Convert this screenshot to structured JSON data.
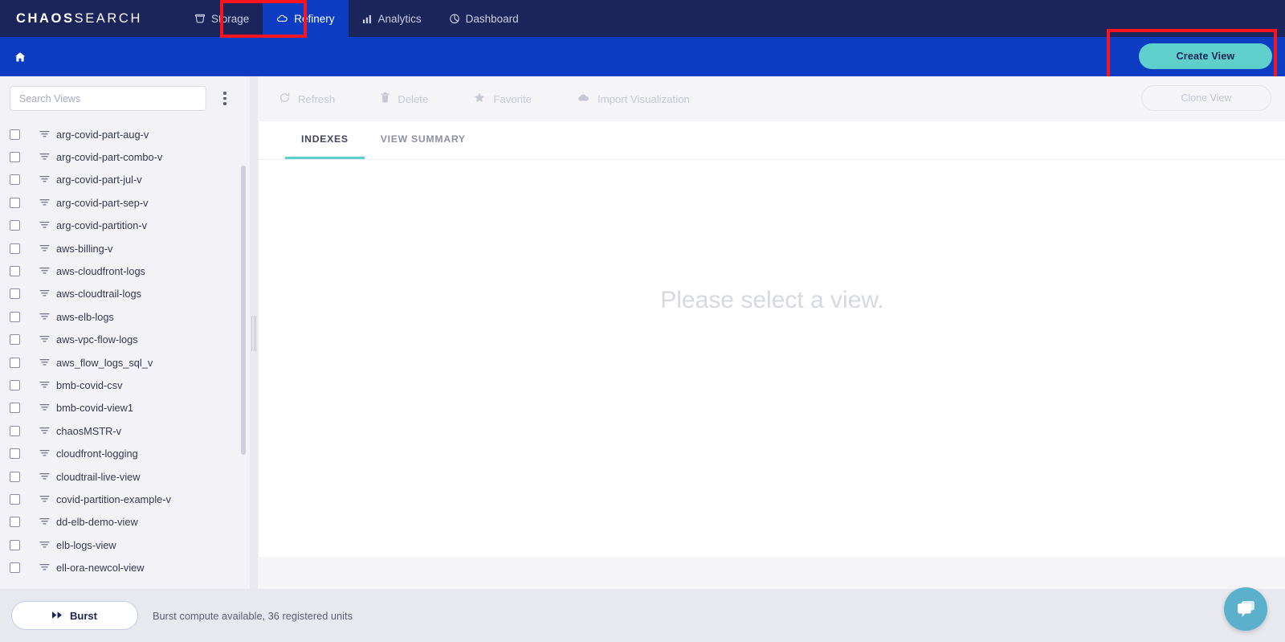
{
  "brand": {
    "bold": "CHAOS",
    "light": "SEARCH"
  },
  "topnav": {
    "items": [
      {
        "label": "Storage",
        "icon": "bucket-icon",
        "active": false
      },
      {
        "label": "Refinery",
        "icon": "cloud-icon",
        "active": true
      },
      {
        "label": "Analytics",
        "icon": "bar-chart-icon",
        "active": false
      },
      {
        "label": "Dashboard",
        "icon": "pie-chart-icon",
        "active": false
      }
    ]
  },
  "subbar": {
    "home_icon": "home-icon",
    "create_view_label": "Create View"
  },
  "sidebar": {
    "search": {
      "placeholder": "Search Views",
      "value": ""
    },
    "menu_icon": "kebab-menu-icon",
    "views": [
      "arg-covid-part-aug-v",
      "arg-covid-part-combo-v",
      "arg-covid-part-jul-v",
      "arg-covid-part-sep-v",
      "arg-covid-partition-v",
      "aws-billing-v",
      "aws-cloudfront-logs",
      "aws-cloudtrail-logs",
      "aws-elb-logs",
      "aws-vpc-flow-logs",
      "aws_flow_logs_sql_v",
      "bmb-covid-csv",
      "bmb-covid-view1",
      "chaosMSTR-v",
      "cloudfront-logging",
      "cloudtrail-live-view",
      "covid-partition-example-v",
      "dd-elb-demo-view",
      "elb-logs-view",
      "ell-ora-newcol-view"
    ]
  },
  "toolbar": {
    "buttons": [
      {
        "label": "Refresh",
        "icon": "refresh-icon"
      },
      {
        "label": "Delete",
        "icon": "trash-icon"
      },
      {
        "label": "Favorite",
        "icon": "star-icon"
      },
      {
        "label": "Import Visualization",
        "icon": "cloud-upload-icon"
      }
    ],
    "clone_label": "Clone View"
  },
  "panel": {
    "tabs": [
      {
        "label": "INDEXES",
        "active": true
      },
      {
        "label": "VIEW SUMMARY",
        "active": false
      }
    ],
    "empty_message": "Please select a view."
  },
  "footer": {
    "burst_label": "Burst",
    "burst_icon": "fast-forward-icon",
    "status": "Burst compute available, 36 registered units",
    "chat_icon": "chat-bubble-icon"
  },
  "colors": {
    "nav_bg": "#1b2559",
    "subbar_bg": "#0b3cc1",
    "accent_teal": "#5ecfca",
    "annotation_red": "#f8151e",
    "chat_blue": "#5bb0cc"
  }
}
